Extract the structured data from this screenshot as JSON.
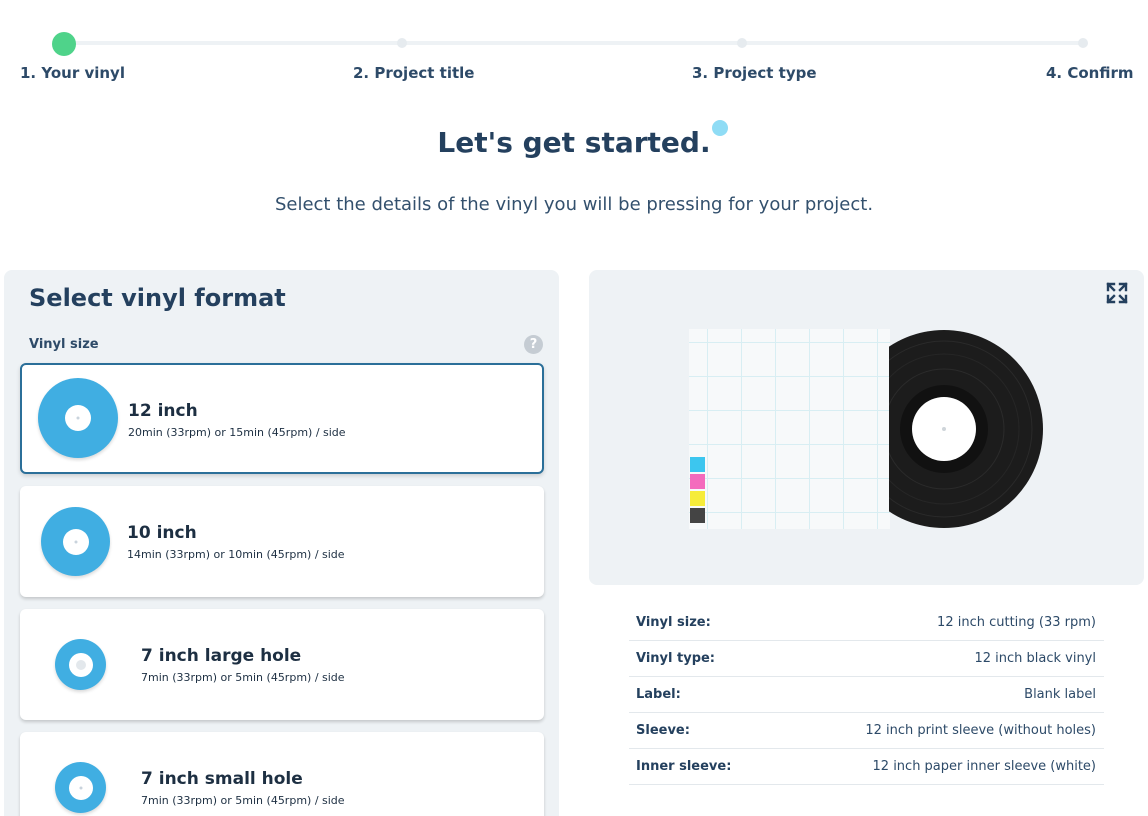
{
  "stepper": {
    "steps": [
      {
        "label": "1. Your vinyl",
        "active": true
      },
      {
        "label": "2. Project title",
        "active": false
      },
      {
        "label": "3. Project type",
        "active": false
      },
      {
        "label": "4. Confirm",
        "active": false
      }
    ]
  },
  "hero": {
    "title": "Let's get started.",
    "subtitle": "Select the details of the vinyl you will be pressing for your project."
  },
  "format_panel": {
    "title": "Select vinyl format",
    "field_label": "Vinyl size",
    "help_icon": "?",
    "options": [
      {
        "title": "12 inch",
        "desc": "20min (33rpm) or 15min (45rpm) / side",
        "selected": true
      },
      {
        "title": "10 inch",
        "desc": "14min (33rpm) or 10min (45rpm) / side",
        "selected": false
      },
      {
        "title": "7 inch large hole",
        "desc": "7min (33rpm) or 5min (45rpm) / side",
        "selected": false
      },
      {
        "title": "7 inch small hole",
        "desc": "7min (33rpm) or 5min (45rpm) / side",
        "selected": false
      }
    ]
  },
  "preview": {
    "expand_icon": "expand-icon",
    "cmyk_colors": [
      "#3cc6ef",
      "#f46bbd",
      "#f6ec3a",
      "#444444"
    ]
  },
  "specs": [
    {
      "key": "Vinyl size:",
      "value": "12 inch cutting (33 rpm)"
    },
    {
      "key": "Vinyl type:",
      "value": "12 inch black vinyl"
    },
    {
      "key": "Label:",
      "value": "Blank label"
    },
    {
      "key": "Sleeve:",
      "value": "12 inch print sleeve (without holes)"
    },
    {
      "key": "Inner sleeve:",
      "value": "12 inch paper inner sleeve (white)"
    }
  ],
  "colors": {
    "accent_green": "#4fd38a",
    "disc_blue": "#40aee2",
    "selected_border": "#2b6f99",
    "heading": "#24405e"
  }
}
